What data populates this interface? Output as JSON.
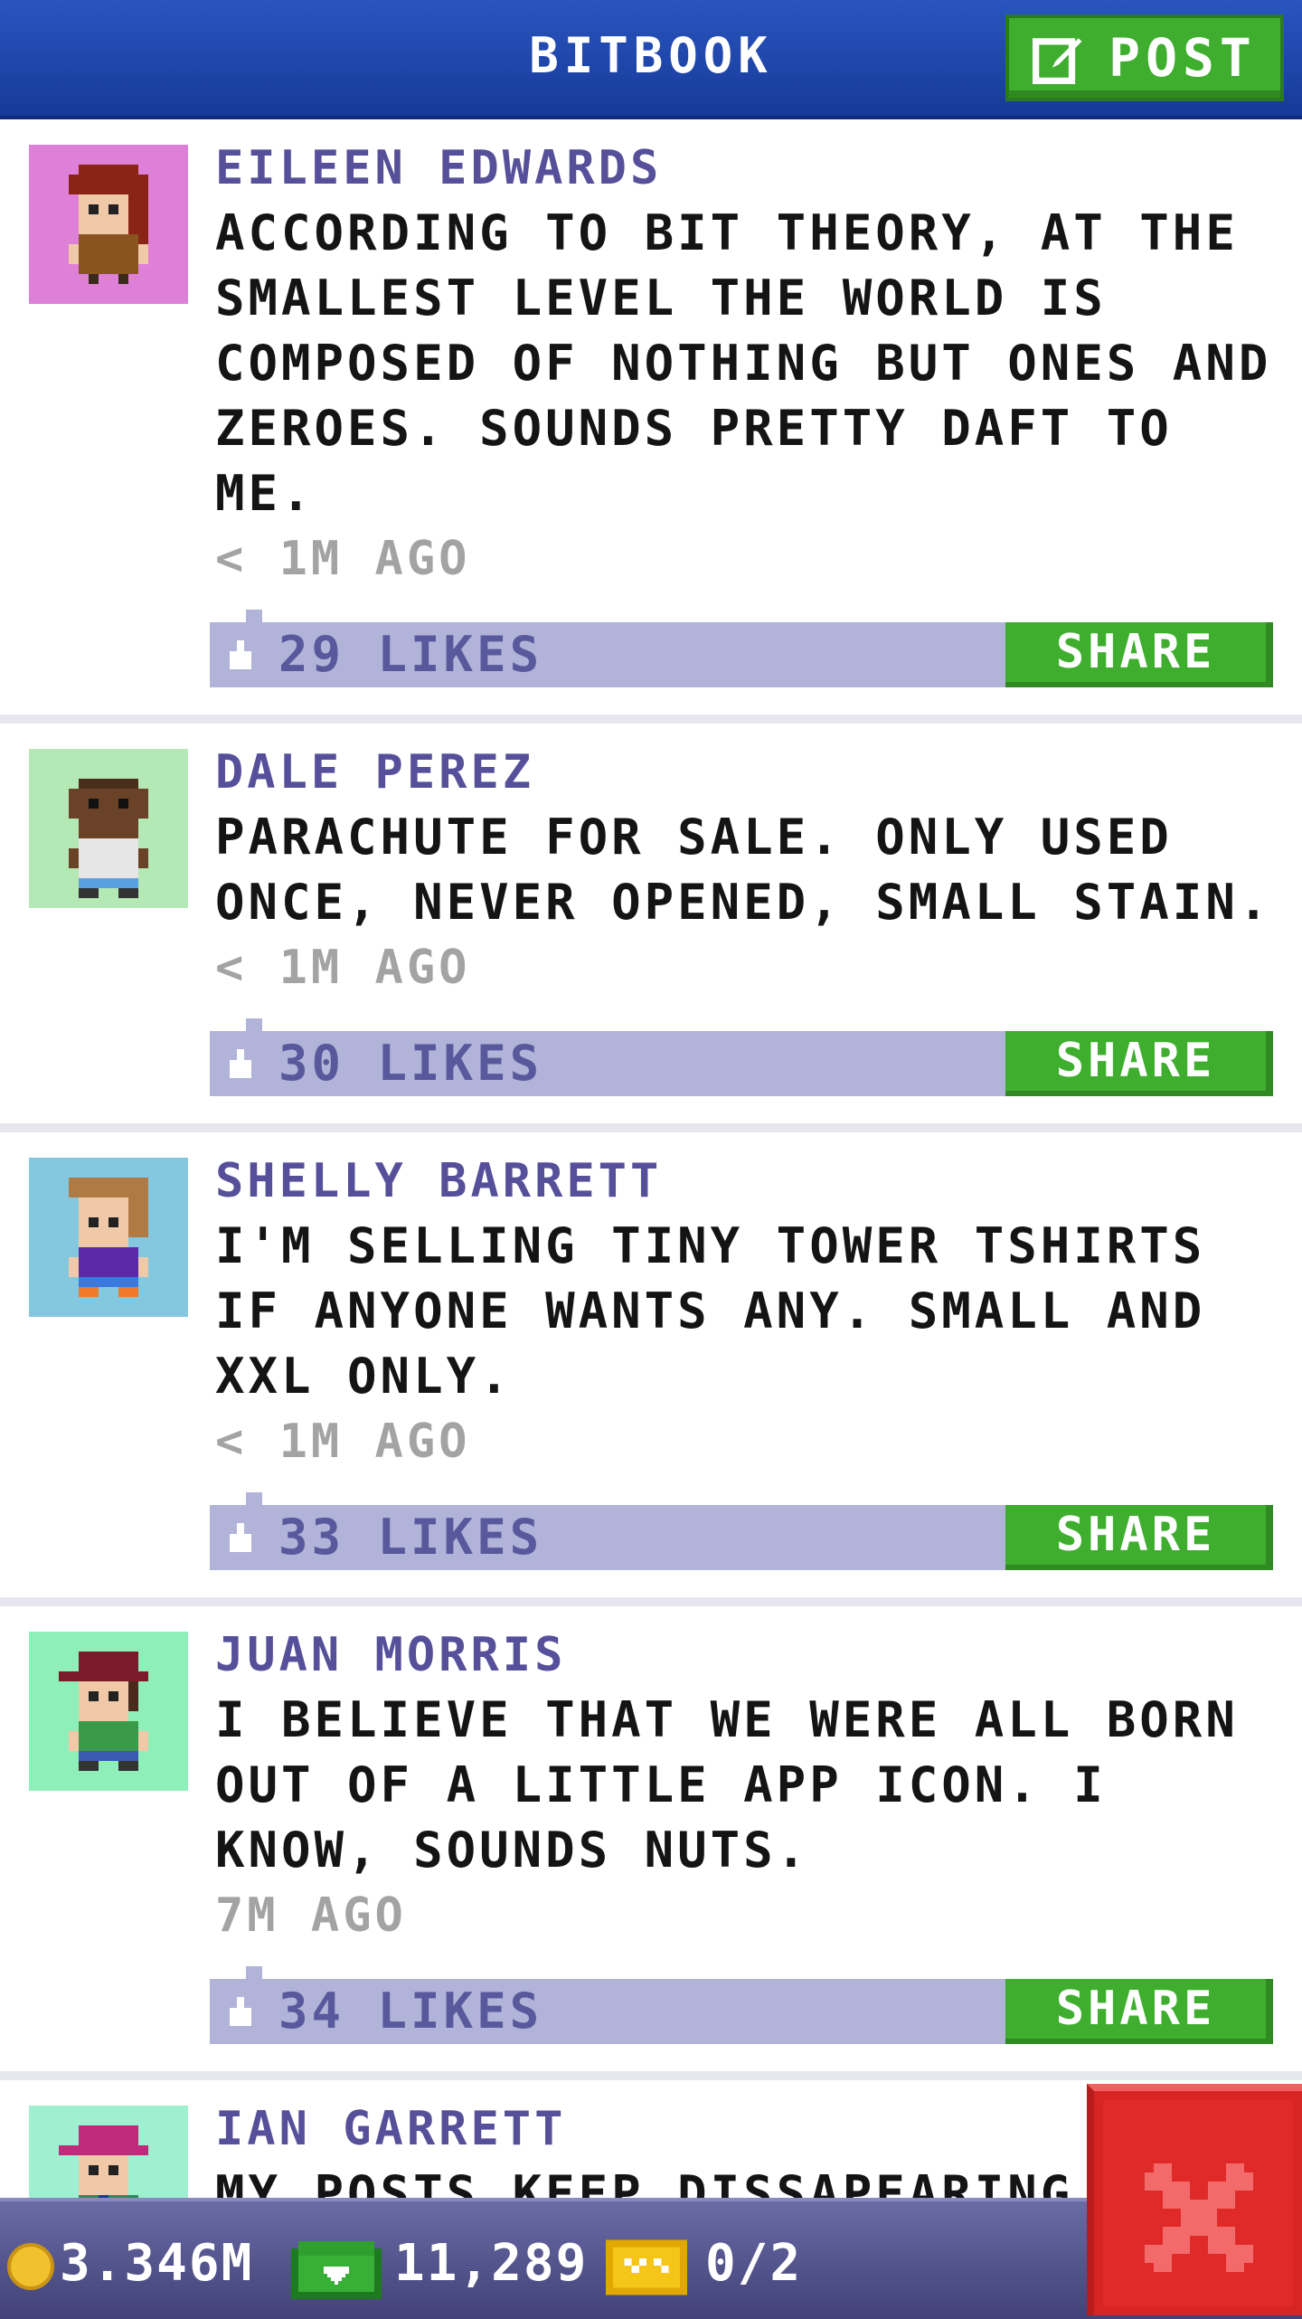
{
  "header": {
    "title": "BITBOOK",
    "post_label": "POST",
    "post_icon": "edit-icon"
  },
  "posts": [
    {
      "author": "EILEEN EDWARDS",
      "text": "ACCORDING TO BIT THEORY, AT THE SMALLEST LEVEL THE WORLD IS COMPOSED OF NOTHING BUT ONES AND ZEROES. SOUNDS PRETTY DAFT TO ME.",
      "time": "< 1M AGO",
      "likes": "29 LIKES",
      "share_label": "SHARE",
      "avatar_bg": "#df80d8"
    },
    {
      "author": "DALE PEREZ",
      "text": "PARACHUTE FOR SALE. ONLY USED ONCE, NEVER OPENED, SMALL STAIN.",
      "time": "< 1M AGO",
      "likes": "30 LIKES",
      "share_label": "SHARE",
      "avatar_bg": "#b4e8b4"
    },
    {
      "author": "SHELLY BARRETT",
      "text": "I'M SELLING TINY TOWER TSHIRTS IF ANYONE WANTS ANY. SMALL AND XXL ONLY.",
      "time": "< 1M AGO",
      "likes": "33 LIKES",
      "share_label": "SHARE",
      "avatar_bg": "#84c8e0"
    },
    {
      "author": "JUAN MORRIS",
      "text": "I BELIEVE THAT WE WERE ALL BORN OUT OF A LITTLE APP ICON. I KNOW, SOUNDS NUTS.",
      "time": "7M AGO",
      "likes": "34 LIKES",
      "share_label": "SHARE",
      "avatar_bg": "#8ef0b8"
    },
    {
      "author": "IAN GARRETT",
      "text": "MY POSTS KEEP DISSAPEARING. STOP CENSORING ME NIMBLEBIT!",
      "time": "",
      "likes": "",
      "share_label": "",
      "avatar_bg": "#9ef0d0"
    }
  ],
  "footer": {
    "coins": "3.346M",
    "bux": "11,289",
    "tickets": "0/2",
    "coin_icon": "coin-icon",
    "bux_icon": "bux-icon",
    "ticket_icon": "ticket-icon"
  },
  "close_icon": "close-icon",
  "colors": {
    "header": "#1f4ab0",
    "accent_green": "#3fae2f",
    "like_bar": "#b1b3d8",
    "author": "#56509a",
    "close_red": "#e02a2a"
  }
}
